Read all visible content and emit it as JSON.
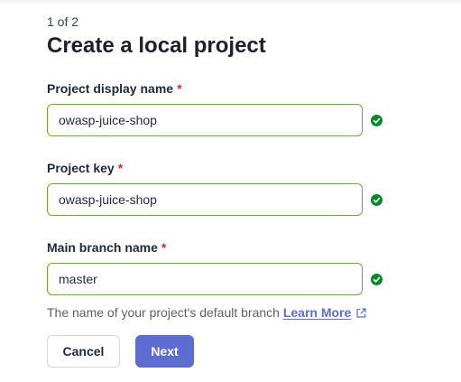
{
  "header": {
    "step": "1 of 2",
    "title": "Create a local project"
  },
  "form": {
    "required_marker": "*",
    "display_name": {
      "label": "Project display name",
      "value": "owasp-juice-shop",
      "status_icon": "check-circle-icon"
    },
    "project_key": {
      "label": "Project key",
      "value": "owasp-juice-shop",
      "status_icon": "check-circle-icon"
    },
    "main_branch": {
      "label": "Main branch name",
      "value": "master",
      "status_icon": "check-circle-icon",
      "hint": "The name of your project's default branch",
      "link_label": "Learn More",
      "link_icon": "external-link-icon"
    }
  },
  "actions": {
    "cancel_label": "Cancel",
    "next_label": "Next"
  },
  "colors": {
    "valid_border": "#6cad27",
    "valid_check": "#008a25",
    "required": "#d02f3a",
    "primary": "#5d6cd0",
    "link": "#5d6cd0"
  }
}
